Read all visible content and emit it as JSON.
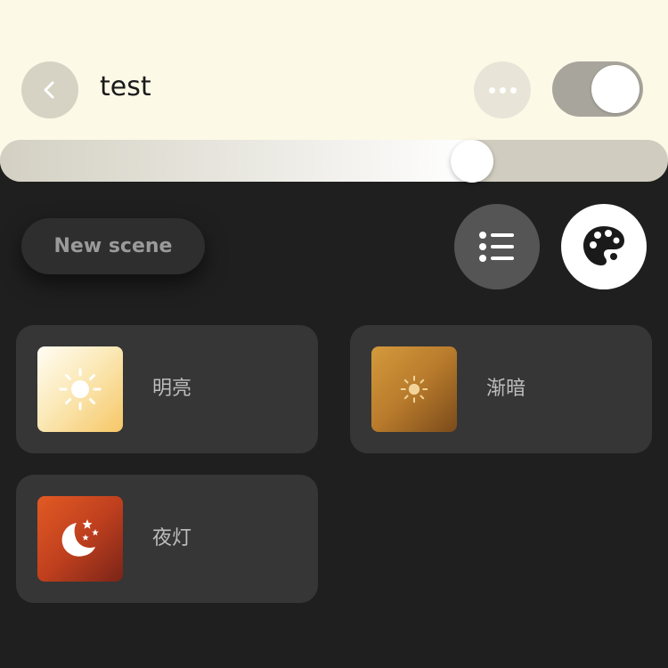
{
  "header": {
    "title": "test",
    "toggle_on": true,
    "brightness": 0.707
  },
  "toolbar": {
    "new_scene_label": "New scene"
  },
  "scenes": [
    {
      "label": "明亮",
      "icon": "sun-icon"
    },
    {
      "label": "渐暗",
      "icon": "sun-icon"
    },
    {
      "label": "夜灯",
      "icon": "moon-stars-icon"
    }
  ],
  "colors": {
    "header_bg": "#fdf9e7",
    "page_bg": "#1f1f1f",
    "card_bg": "#363636",
    "accent_bright": "#f6c766",
    "accent_dim": "#b87b2c",
    "accent_night": "#c0401e"
  }
}
